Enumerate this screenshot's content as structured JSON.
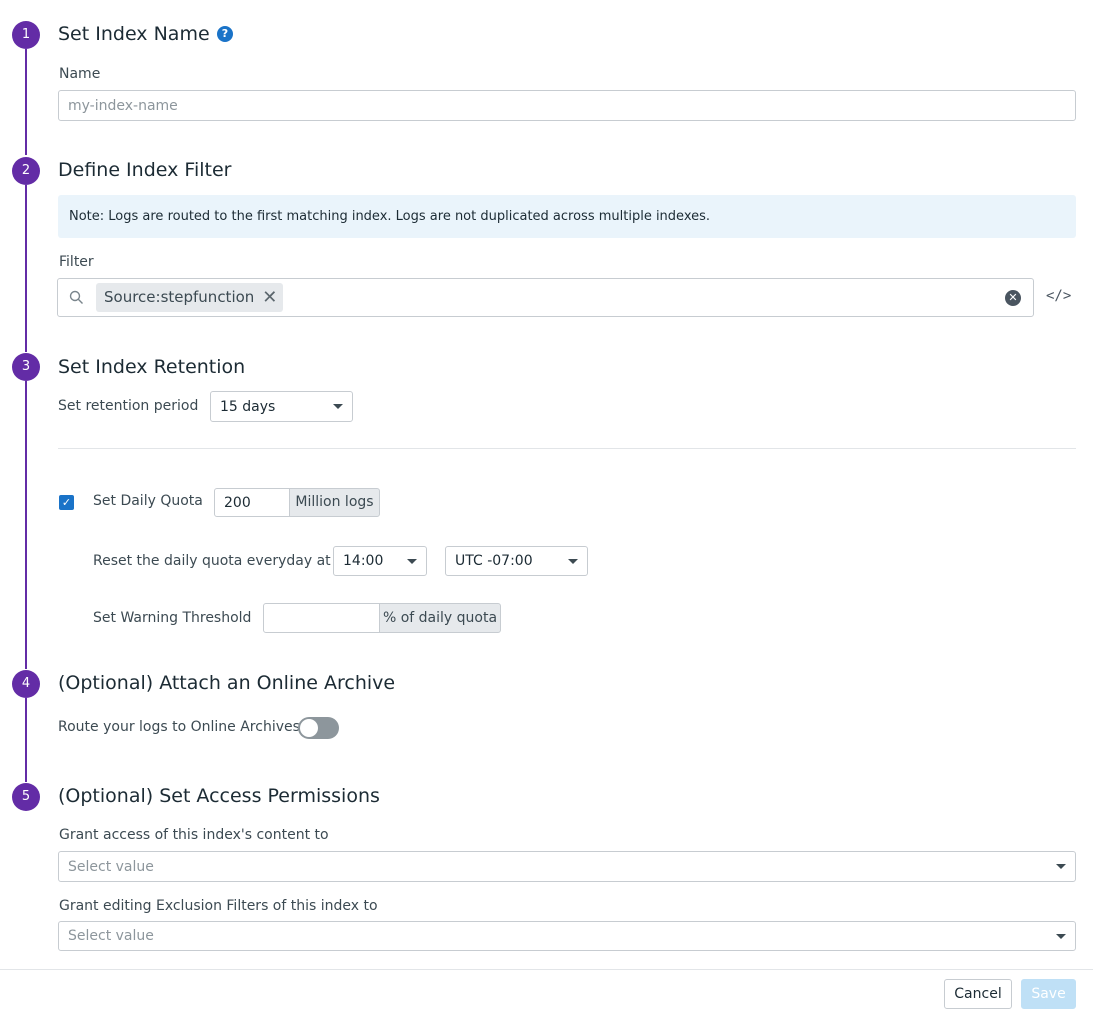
{
  "steps": [
    {
      "number": "1",
      "title": "Set Index Name"
    },
    {
      "number": "2",
      "title": "Define Index Filter"
    },
    {
      "number": "3",
      "title": "Set Index Retention"
    },
    {
      "number": "4",
      "title": "(Optional) Attach an Online Archive"
    },
    {
      "number": "5",
      "title": "(Optional) Set Access Permissions"
    }
  ],
  "name_section": {
    "label": "Name",
    "placeholder": "my-index-name",
    "value": "",
    "help_icon": "?"
  },
  "filter_section": {
    "note": "Note: Logs are routed to the first matching index. Logs are not duplicated across multiple indexes.",
    "label": "Filter",
    "chip": "Source:stepfunction",
    "chip_remove": "✕",
    "clear": "✕",
    "code_toggle": "</>"
  },
  "retention_section": {
    "period_label": "Set retention period",
    "period_value": "15 days",
    "daily_quota": {
      "checked": true,
      "check_glyph": "✓",
      "label": "Set Daily Quota",
      "value": "200",
      "unit": "Million logs"
    },
    "reset": {
      "label": "Reset the daily quota everyday at",
      "time": "14:00",
      "timezone": "UTC -07:00"
    },
    "warning": {
      "label": "Set Warning Threshold",
      "value": "",
      "unit": "% of daily quota"
    }
  },
  "archive_section": {
    "label": "Route your logs to Online Archives",
    "enabled": false
  },
  "permissions_section": {
    "content_label": "Grant access of this index's content to",
    "content_placeholder": "Select value",
    "exclusion_label": "Grant editing Exclusion Filters of this index to",
    "exclusion_placeholder": "Select value"
  },
  "footer": {
    "cancel_label": "Cancel",
    "save_label": "Save"
  },
  "colors": {
    "step_purple": "#632ca6",
    "accent_blue": "#1a73c8",
    "note_bg": "#eaf4fb",
    "save_disabled": "#bfe0f6"
  }
}
